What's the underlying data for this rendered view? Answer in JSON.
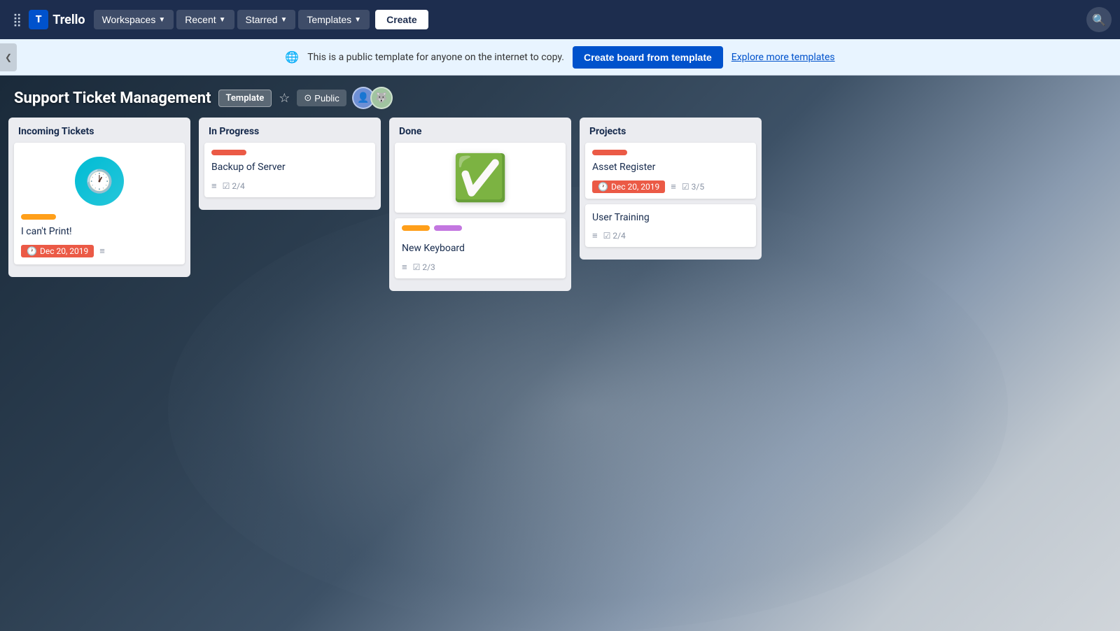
{
  "navbar": {
    "logo_text": "Trello",
    "workspaces_label": "Workspaces",
    "recent_label": "Recent",
    "starred_label": "Starred",
    "templates_label": "Templates",
    "create_label": "Create"
  },
  "banner": {
    "globe_icon": "🌐",
    "text": "This is a public template for anyone on the internet to copy.",
    "cta_label": "Create board from template",
    "explore_label": "Explore more templates",
    "toggle_icon": "❮"
  },
  "board": {
    "title": "Support Ticket Management",
    "template_badge": "Template",
    "public_label": "Public",
    "star_icon": "☆",
    "globe_icon": "⊙"
  },
  "lists": [
    {
      "id": "incoming",
      "title": "Incoming Tickets",
      "cards": [
        {
          "id": "clock-card",
          "type": "clock",
          "label_color": "orange",
          "title": "I can't Print!",
          "date": "Dec 20, 2019",
          "has_menu": true
        }
      ]
    },
    {
      "id": "inprogress",
      "title": "In Progress",
      "cards": [
        {
          "id": "backup",
          "type": "normal",
          "label_color": "red",
          "title": "Backup of Server",
          "has_menu": true,
          "checklist": "2/4"
        }
      ]
    },
    {
      "id": "done",
      "title": "Done",
      "cards": [
        {
          "id": "checkmark",
          "type": "checkmark",
          "labels": [
            "orange",
            "purple"
          ],
          "title": "New Keyboard",
          "has_menu": true,
          "checklist": "2/3"
        }
      ]
    },
    {
      "id": "projects",
      "title": "Projects",
      "cards": [
        {
          "id": "asset",
          "type": "normal",
          "label_color": "red",
          "title": "Asset Register",
          "date": "Dec 20, 2019",
          "has_menu": true,
          "checklist": "3/5"
        },
        {
          "id": "training",
          "type": "minimal",
          "title": "User Training",
          "has_menu": true,
          "checklist": "2/4"
        }
      ]
    }
  ]
}
